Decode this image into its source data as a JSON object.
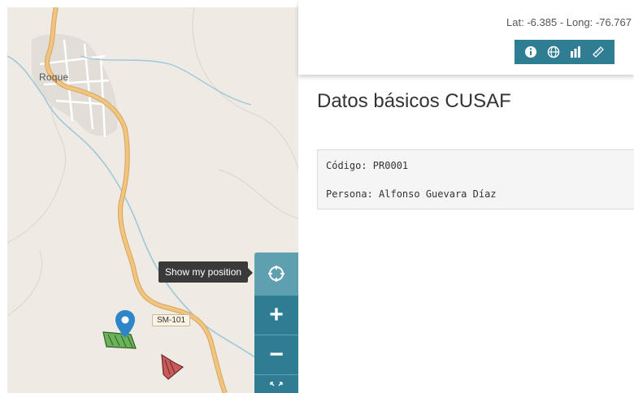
{
  "map": {
    "town_label": "Roque",
    "road_label": "SM-101",
    "tooltip": "Show my position",
    "controls": [
      {
        "name": "locate-icon"
      },
      {
        "name": "zoom-in",
        "symbol": "+"
      },
      {
        "name": "zoom-out",
        "symbol": "−"
      },
      {
        "name": "fullscreen-icon"
      }
    ],
    "colors": {
      "road": "#f0c57f",
      "river": "#9ec9d9",
      "marker": "#2e86c9",
      "parcel_green": "#6bb35a",
      "parcel_red": "#c85a5a"
    }
  },
  "header": {
    "coordinates": "Lat: -6.385 - Long: -76.767",
    "toolbar": [
      {
        "name": "info-icon"
      },
      {
        "name": "globe-icon"
      },
      {
        "name": "chart-icon"
      },
      {
        "name": "ruler-icon"
      }
    ],
    "accent": "#2f7d93"
  },
  "content": {
    "title": "Datos básicos CUSAF",
    "codigo": "Código: PR0001",
    "persona": "Persona: Alfonso Guevara Díaz"
  }
}
